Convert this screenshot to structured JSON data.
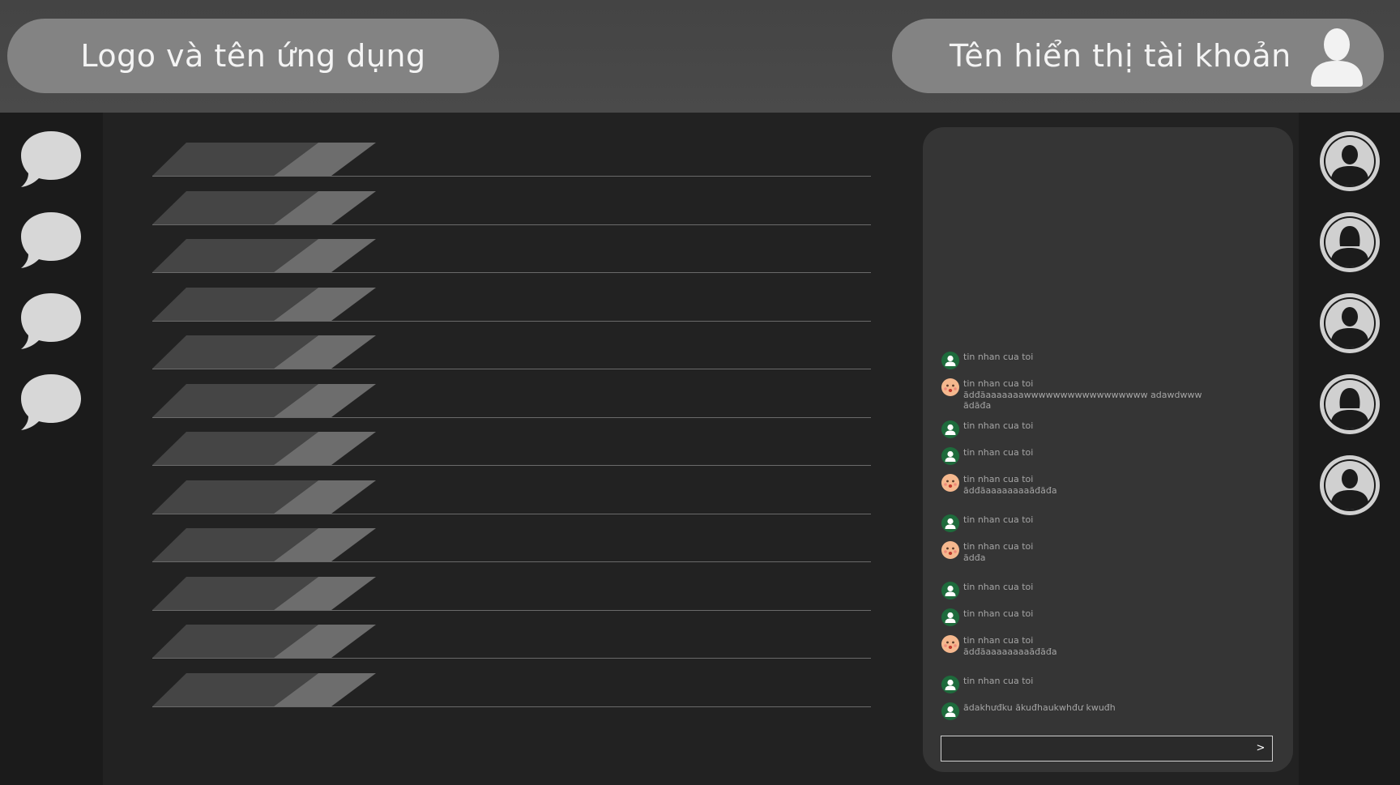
{
  "header": {
    "app_title": "Logo và tên ứng dụng",
    "account_name": "Tên hiển thị tài khoản",
    "avatar_icon": "user-silhouette-icon"
  },
  "left_rail": {
    "items": [
      {
        "icon": "speech-bubble-icon"
      },
      {
        "icon": "speech-bubble-icon"
      },
      {
        "icon": "speech-bubble-icon"
      },
      {
        "icon": "speech-bubble-icon"
      }
    ]
  },
  "list": {
    "row_count": 12
  },
  "chat": {
    "messages": [
      {
        "sender": "green",
        "lines": [
          "tin nhan cua toi"
        ]
      },
      {
        "sender": "face",
        "lines": [
          "tin nhan cua toi",
          "ădđăaaaaaaawwwwwwwwwwwwwwwww adawdwww",
          "ădăđa"
        ]
      },
      {
        "sender": "green",
        "lines": [
          "tin nhan cua toi"
        ]
      },
      {
        "sender": "green",
        "lines": [
          "tin nhan cua toi"
        ]
      },
      {
        "sender": "face",
        "lines": [
          "tin nhan cua toi",
          "ădđăaaaaaaaaăđăđa"
        ]
      },
      {
        "sender": "green",
        "lines": [
          "tin nhan cua toi"
        ]
      },
      {
        "sender": "face",
        "lines": [
          "tin nhan cua toi",
          "ădđa"
        ]
      },
      {
        "sender": "green",
        "lines": [
          "tin nhan cua toi"
        ]
      },
      {
        "sender": "green",
        "lines": [
          "tin nhan cua toi"
        ]
      },
      {
        "sender": "face",
        "lines": [
          "tin nhan cua toi",
          "ădđăaaaaaaaaăđăđa"
        ]
      },
      {
        "sender": "green",
        "lines": [
          "tin nhan cua toi"
        ]
      },
      {
        "sender": "green",
        "lines": [
          "ădakhưđku ăkuđhaukwhđư kwuđh"
        ]
      }
    ],
    "input_value": "",
    "send_label": ">"
  },
  "right_rail": {
    "avatars": [
      {
        "icon": "male-avatar-icon"
      },
      {
        "icon": "female-avatar-icon"
      },
      {
        "icon": "male-avatar-icon"
      },
      {
        "icon": "female-avatar-icon"
      },
      {
        "icon": "male-avatar-icon"
      }
    ]
  },
  "colors": {
    "header_bg": "#474747",
    "pill_bg": "#838383",
    "body_bg": "#222222",
    "rail_bg": "#1b1b1b",
    "panel_bg": "#353535",
    "green_avatar": "#1e6b3c",
    "face_avatar": "#f5b88e"
  }
}
